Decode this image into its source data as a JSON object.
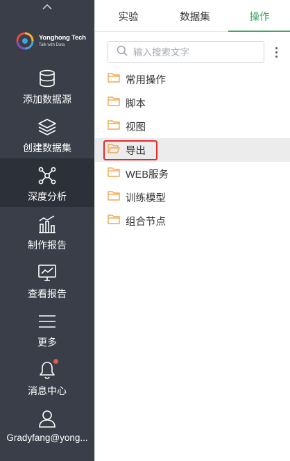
{
  "sidebar": {
    "logo": {
      "name": "Yonghong Tech",
      "tagline": "Talk with Data"
    },
    "items": [
      {
        "label": "添加数据源",
        "icon": "database-icon"
      },
      {
        "label": "创建数据集",
        "icon": "layers-icon"
      },
      {
        "label": "深度分析",
        "icon": "network-icon",
        "active": true
      },
      {
        "label": "制作报告",
        "icon": "bar-chart-icon"
      },
      {
        "label": "查看报告",
        "icon": "monitor-chart-icon"
      },
      {
        "label": "更多",
        "icon": "menu-icon"
      },
      {
        "label": "消息中心",
        "icon": "bell-icon"
      },
      {
        "label": "Gradyfang@yong...",
        "icon": "user-icon"
      }
    ]
  },
  "tabs": [
    {
      "label": "实验"
    },
    {
      "label": "数据集"
    },
    {
      "label": "操作",
      "active": true
    }
  ],
  "search": {
    "placeholder": "输入搜索文字"
  },
  "tree": [
    {
      "label": "常用操作"
    },
    {
      "label": "脚本"
    },
    {
      "label": "视图"
    },
    {
      "label": "导出",
      "selected": true
    },
    {
      "label": "WEB服务"
    },
    {
      "label": "训练模型"
    },
    {
      "label": "组合节点"
    }
  ],
  "colors": {
    "sidebar_bg": "#393e48",
    "sidebar_active_bg": "#2c3038",
    "accent_green": "#41a563",
    "folder_orange": "#f0a550",
    "highlight_red": "#e32b2b",
    "notification_dot": "#e05a4b"
  }
}
